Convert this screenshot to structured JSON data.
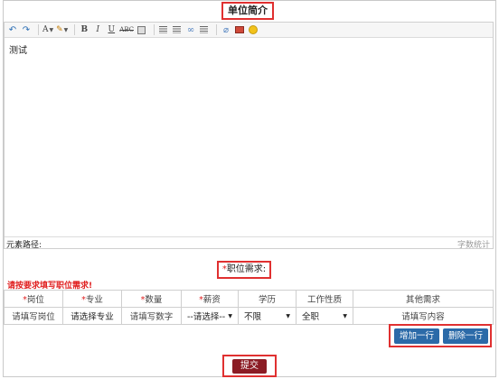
{
  "section": {
    "title": "单位简介"
  },
  "toolbar": {
    "font_color_label": "A",
    "bold_label": "B",
    "italic_label": "I",
    "underline_label": "U",
    "strike_label": "ABC"
  },
  "editor": {
    "content": "测试",
    "path_label": "元素路径:",
    "word_count_label": "字数统计"
  },
  "requirements": {
    "star": "*",
    "header": "职位需求:",
    "hint": "请按要求填写职位需求!",
    "columns": [
      {
        "label": "岗位",
        "required": true
      },
      {
        "label": "专业",
        "required": true
      },
      {
        "label": "数量",
        "required": true
      },
      {
        "label": "薪资",
        "required": true
      },
      {
        "label": "学历",
        "required": false
      },
      {
        "label": "工作性质",
        "required": false
      },
      {
        "label": "其他需求",
        "required": false
      }
    ],
    "row": {
      "position_placeholder": "请填写岗位",
      "major_value": "请选择专业",
      "quantity_placeholder": "请填写数字",
      "salary_value": "--请选择--",
      "education_value": "不限",
      "job_type_value": "全职",
      "other_placeholder": "请填写内容"
    },
    "add_row_label": "增加一行",
    "delete_row_label": "删除一行",
    "submit_label": "提交"
  },
  "colors": {
    "highlight_border": "#e03030",
    "button_blue": "#2b6aa8",
    "submit_red": "#8b1c24",
    "required_star": "#e02020"
  }
}
